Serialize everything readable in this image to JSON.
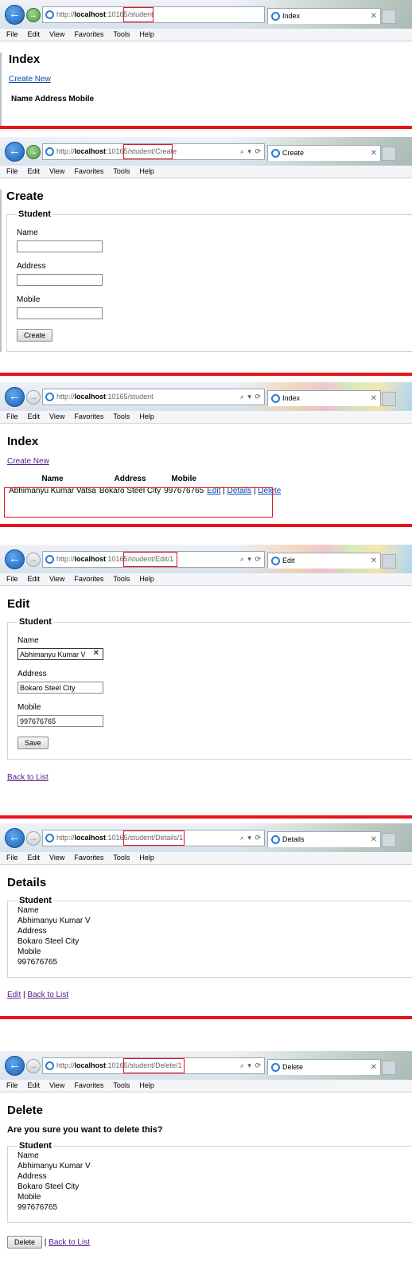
{
  "menu": [
    "File",
    "Edit",
    "View",
    "Favorites",
    "Tools",
    "Help"
  ],
  "url_prefix": "http://",
  "url_host": "localhost",
  "url_port": ":10165",
  "panels": {
    "index_empty": {
      "url_path": "/student",
      "tab_title": "Index",
      "heading": "Index",
      "create_link": "Create New",
      "columns_row": "Name Address Mobile"
    },
    "create": {
      "url_path": "/student/Create",
      "tab_title": "Create",
      "heading": "Create",
      "legend": "Student",
      "fields": [
        {
          "label": "Name",
          "value": ""
        },
        {
          "label": "Address",
          "value": ""
        },
        {
          "label": "Mobile",
          "value": ""
        }
      ],
      "button": "Create"
    },
    "index_list": {
      "url_path": "/student",
      "tab_title": "Index",
      "heading": "Index",
      "create_link": "Create New",
      "columns": [
        "Name",
        "Address",
        "Mobile"
      ],
      "rows": [
        {
          "name": "Abhimanyu Kumar Vatsa",
          "address": "Bokaro Steel City",
          "mobile": "997676765",
          "edit": "Edit",
          "details": "Details",
          "delete": "Delete",
          "sep": "|"
        }
      ]
    },
    "edit": {
      "url_path": "/student/Edit/1",
      "tab_title": "Edit",
      "heading": "Edit",
      "legend": "Student",
      "fields": [
        {
          "label": "Name",
          "value": "Abhimanyu Kumar V"
        },
        {
          "label": "Address",
          "value": "Bokaro Steel City"
        },
        {
          "label": "Mobile",
          "value": "997676765"
        }
      ],
      "clear_glyph": "✕",
      "button": "Save",
      "back_link": "Back to List"
    },
    "details": {
      "url_path": "/student/Details/1",
      "tab_title": "Details",
      "heading": "Details",
      "legend": "Student",
      "items": [
        {
          "label": "Name",
          "value": "Abhimanyu Kumar V"
        },
        {
          "label": "Address",
          "value": "Bokaro Steel City"
        },
        {
          "label": "Mobile",
          "value": "997676765"
        }
      ],
      "edit_link": "Edit",
      "sep": "|",
      "back_link": "Back to List"
    },
    "delete": {
      "url_path": "/student/Delete/1",
      "tab_title": "Delete",
      "heading": "Delete",
      "question": "Are you sure you want to delete this?",
      "legend": "Student",
      "items": [
        {
          "label": "Name",
          "value": "Abhimanyu Kumar V"
        },
        {
          "label": "Address",
          "value": "Bokaro Steel City"
        },
        {
          "label": "Mobile",
          "value": "997676765"
        }
      ],
      "button": "Delete",
      "sep": "|",
      "back_link": "Back to List"
    }
  },
  "icons": {
    "back": "back-arrow-icon",
    "forward": "forward-arrow-icon",
    "ie": "internet-explorer-icon",
    "close": "close-icon",
    "search": "search-icon",
    "refresh": "refresh-icon"
  },
  "colors": {
    "highlight": "#e8141c",
    "link": "#0645ad",
    "visited_link": "#551a8b",
    "back_button": "#1b5fb8"
  }
}
